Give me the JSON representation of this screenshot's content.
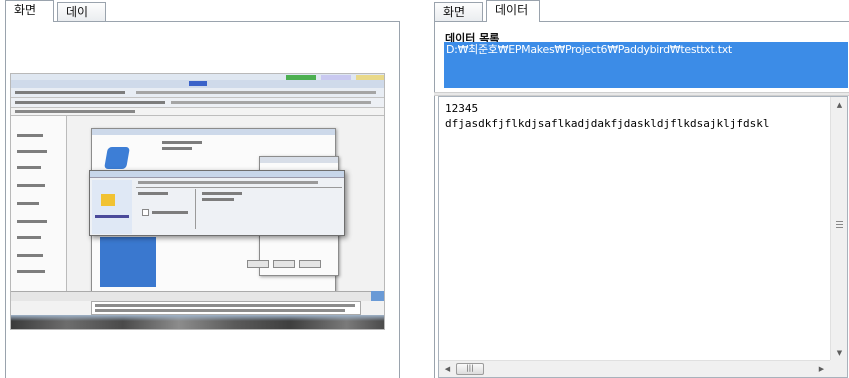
{
  "left_panel": {
    "tabs": [
      {
        "label": "화면",
        "active": true
      },
      {
        "label": "데이터",
        "active": false
      }
    ]
  },
  "right_panel": {
    "tabs": [
      {
        "label": "화면",
        "active": false
      },
      {
        "label": "데이터",
        "active": true
      }
    ],
    "list_header": "데이터 목록",
    "list_items": [
      "D:₩최준호₩EPMakes₩Project6₩Paddybird₩testtxt.txt"
    ],
    "selected_index": 0,
    "content_lines": [
      "12345",
      "dfjasdkfjflkdjsaflkadjdakfjdaskldjflkdsajkljfdskl"
    ],
    "scroll": {
      "up_arrow": "▲",
      "down_arrow": "▼",
      "left_arrow": "◀",
      "right_arrow": "▶"
    }
  },
  "colors": {
    "selection": "#3c8ce7",
    "tab_border": "#9aa3ad",
    "scrollbar_bg": "#f0f0f0"
  },
  "icons": {
    "screenshot_thumbnail": "captured-desktop-screenshot",
    "hthumb_grip": "|||"
  }
}
